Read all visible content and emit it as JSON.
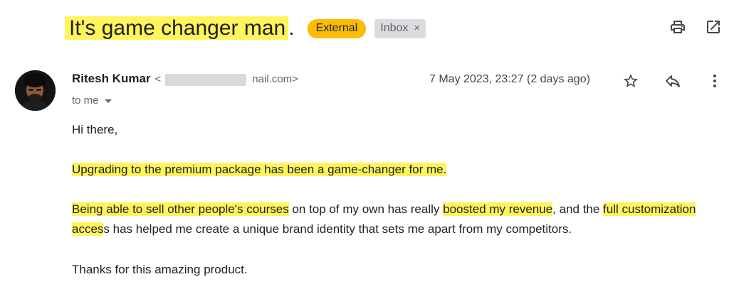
{
  "subject": {
    "title": "It's game changer man",
    "title_suffix": ".",
    "tag_external": "External",
    "tag_inbox": "Inbox",
    "tag_inbox_close": "×"
  },
  "toolbar": {
    "print_icon": "print-icon",
    "open_new_window_icon": "open-in-new-window-icon"
  },
  "message": {
    "sender_name": "Ritesh Kumar",
    "sender_email_prefix": "<",
    "sender_email_suffix": "nail.com>",
    "date": "7 May 2023, 23:27 (2 days ago)",
    "to_line": "to me",
    "icons": [
      "star-icon",
      "reply-icon",
      "more-vert-icon"
    ]
  },
  "body": {
    "greeting": "Hi there,",
    "para1": "Upgrading to the premium package has been a game-changer for me.",
    "para2": {
      "hl1": "Being able to sell other people's courses",
      "t1": " on top of my own has really ",
      "hl2": "boosted my revenue",
      "t2": ", and the ",
      "hl3": "full customization acces",
      "t3": "s has helped me create a unique brand identity that sets me apart from my competitors."
    },
    "closing": "Thanks for this amazing product."
  },
  "colors": {
    "highlight": "#fff45c",
    "external_tag": "#fbbc04",
    "inbox_tag": "#dadce0"
  }
}
